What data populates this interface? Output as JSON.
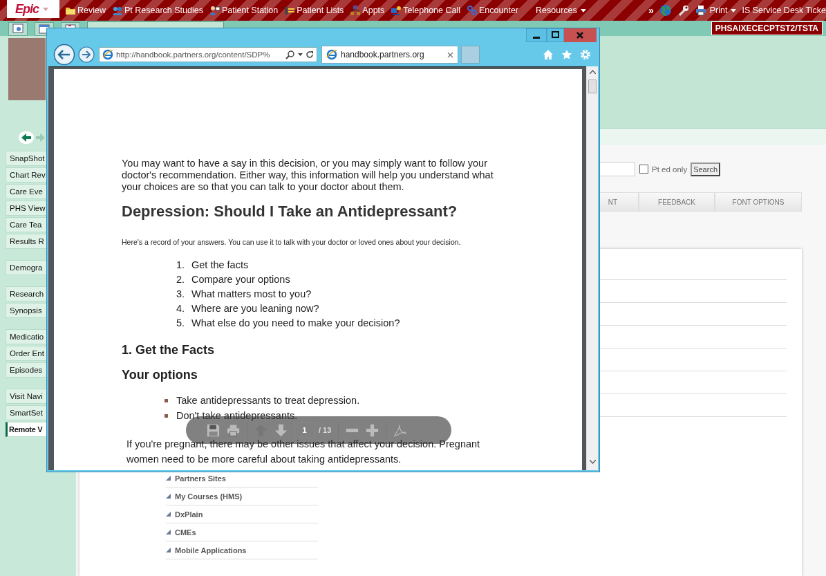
{
  "app_toolbar": {
    "logo": "Epic",
    "items": [
      {
        "label": "Review",
        "menu": false
      },
      {
        "label": "Pt Research Studies",
        "menu": false
      },
      {
        "label": "Patient Station",
        "menu": false
      },
      {
        "label": "Patient Lists",
        "menu": false
      },
      {
        "label": "Appts",
        "menu": false
      },
      {
        "label": "Telephone Call",
        "menu": false
      },
      {
        "label": "Encounter",
        "menu": false
      },
      {
        "label": "Resources",
        "menu": true
      }
    ],
    "more": "»",
    "tools": [
      {
        "label": "Print",
        "menu": true
      },
      {
        "label": "IS Service Desk Ticke",
        "menu": false
      }
    ]
  },
  "environment": "PHSAIXECECPTST2/TSTA",
  "sidebar": {
    "groups": [
      [
        {
          "label": "SnapShot",
          "selected": false
        },
        {
          "label": "Chart Rev",
          "selected": false
        },
        {
          "label": "Care Eve",
          "selected": false
        },
        {
          "label": "PHS View",
          "selected": false
        },
        {
          "label": "Care Tea",
          "selected": false
        },
        {
          "label": "Results R",
          "selected": false
        }
      ],
      [
        {
          "label": "Demogra",
          "selected": false
        }
      ],
      [
        {
          "label": "Research",
          "selected": false
        },
        {
          "label": "Synopsis",
          "selected": false
        }
      ],
      [
        {
          "label": "Medicatio",
          "selected": false
        },
        {
          "label": "Order Ent",
          "selected": false
        },
        {
          "label": "Episodes",
          "selected": false
        }
      ],
      [
        {
          "label": "Visit Navi",
          "selected": false
        },
        {
          "label": "SmartSet",
          "selected": false
        },
        {
          "label": "Remote V",
          "selected": true
        }
      ]
    ]
  },
  "search": {
    "checkbox": {
      "label": "Pt ed only",
      "checked": false
    },
    "button": "Search"
  },
  "content_tabs": [
    {
      "label": "NT"
    },
    {
      "label": "FEEDBACK"
    },
    {
      "label": "FONT OPTIONS"
    }
  ],
  "resources": [
    {
      "label": "Partners Sites"
    },
    {
      "label": "My Courses (HMS)"
    },
    {
      "label": "DxPlain"
    },
    {
      "label": "CMEs"
    },
    {
      "label": "Mobile Applications"
    }
  ],
  "browser": {
    "url": "http://handbook.partners.org/content/SDP%",
    "tabs": [
      {
        "title": "handbook.partners.org",
        "selected": true
      }
    ],
    "document": {
      "intro": "You may want to have a say in this decision, or you may simply want to follow your doctor's recommendation. Either way, this information will help you understand what your choices are so that you can talk to your doctor about them.",
      "title": "Depression: Should I Take an Antidepressant?",
      "note": "Here's a record of your answers. You can use it to talk with your doctor or loved ones about your decision.",
      "steps": [
        {
          "number": "1.",
          "text": "Get the facts"
        },
        {
          "number": "2.",
          "text": "Compare your options"
        },
        {
          "number": "3.",
          "text": "What matters most to you?"
        },
        {
          "number": "4.",
          "text": "Where are you leaning now?"
        },
        {
          "number": "5.",
          "text": "What else do you need to make your decision?"
        }
      ],
      "section": "1. Get the Facts",
      "subsection": "Your options",
      "bullets": [
        "Take antidepressants to treat depression.",
        "Don't take antidepressants."
      ],
      "paragraph": "If you're pregnant, there may be other issues that affect your decision. Pregnant women need to be more careful about taking antidepressants."
    },
    "pdf_toolbar": {
      "page": "1",
      "total": "/ 13"
    }
  }
}
